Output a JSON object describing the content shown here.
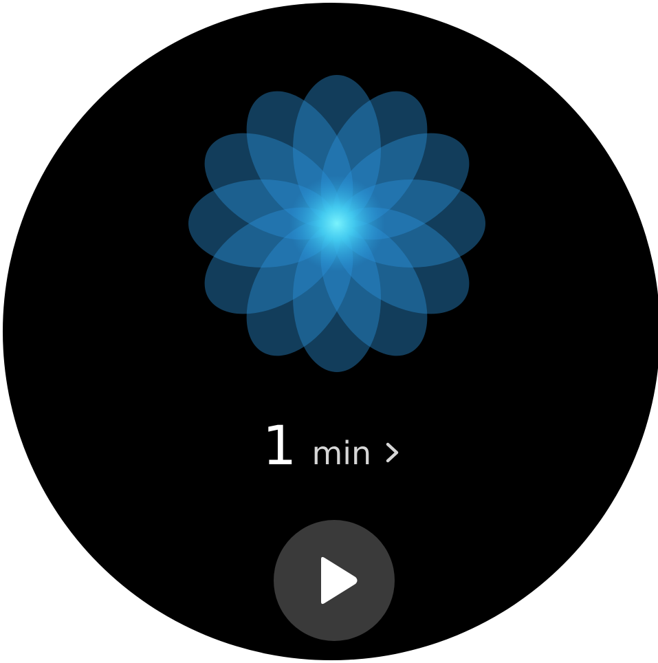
{
  "timer": {
    "value": "1",
    "unit": "min"
  },
  "icons": {
    "flower": "breathing-flower-icon",
    "chevron": "chevron-right-icon",
    "play": "play-icon"
  },
  "colors": {
    "background": "#000000",
    "petal": "#2a8fd6",
    "center_glow": "#5ff0ff",
    "play_button": "#3a3a3a"
  }
}
